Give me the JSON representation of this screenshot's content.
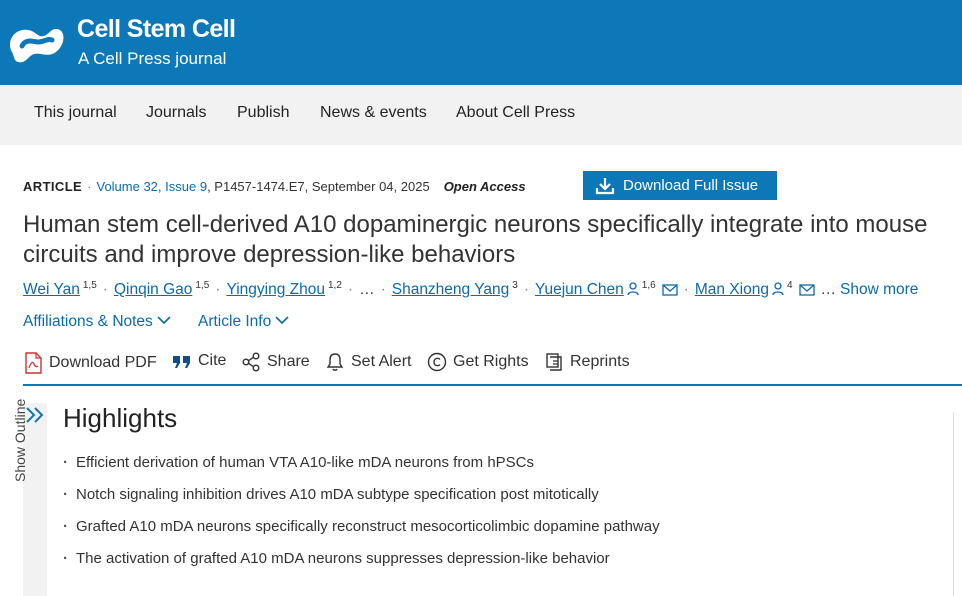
{
  "brand": {
    "title": "Cell Stem Cell",
    "subtitle": "A Cell Press journal",
    "color": "#0d78b8"
  },
  "nav": {
    "items": [
      "This journal",
      "Journals",
      "Publish",
      "News & events",
      "About Cell Press"
    ]
  },
  "article": {
    "type": "ARTICLE",
    "volume_issue": "Volume 32, Issue 9",
    "pages_date": "P1457-1474.E7, September 04, 2025",
    "access": "Open Access",
    "download_issue_label": "Download Full Issue",
    "title": "Human stem cell-derived A10 dopaminergic neurons specifically integrate into mouse circuits and improve depression-like behaviors"
  },
  "authors": [
    {
      "name": "Wei Yan",
      "aff": "1,5"
    },
    {
      "name": "Qinqin Gao",
      "aff": "1,5"
    },
    {
      "name": "Yingying Zhou",
      "aff": "1,2"
    },
    {
      "name": "Shanzheng Yang",
      "aff": "3"
    },
    {
      "name": "Yuejun Chen",
      "aff": "1,6"
    },
    {
      "name": "Man Xiong",
      "aff": "4"
    }
  ],
  "authors_ellipsis": "…",
  "authors_trailing": "…",
  "show_more_label": "Show more",
  "info_links": {
    "affiliations": "Affiliations & Notes",
    "article_info": "Article Info"
  },
  "toolbar": {
    "download_pdf": "Download PDF",
    "cite": "Cite",
    "share": "Share",
    "set_alert": "Set Alert",
    "get_rights": "Get Rights",
    "reprints": "Reprints"
  },
  "outline": {
    "label": "Show Outline"
  },
  "highlights": {
    "heading": "Highlights",
    "items": [
      "Efficient derivation of human VTA A10-like mDA neurons from hPSCs",
      "Notch signaling inhibition drives A10 mDA subtype specification post mitotically",
      "Grafted A10 mDA neurons specifically reconstruct mesocorticolimbic dopamine pathway",
      "The activation of grafted A10 mDA neurons suppresses depression-like behavior"
    ]
  },
  "icons": {
    "logo": "cell-press-logo",
    "download": "download-icon",
    "pdf": "pdf-file-icon",
    "cite": "quote-icon",
    "share": "share-icon",
    "alert": "bell-icon",
    "rights": "copyright-icon",
    "reprints": "reprint-icon",
    "person": "person-icon",
    "email": "envelope-icon",
    "chevron": "chevron-down-icon",
    "outline": "double-chevron-right-icon"
  }
}
